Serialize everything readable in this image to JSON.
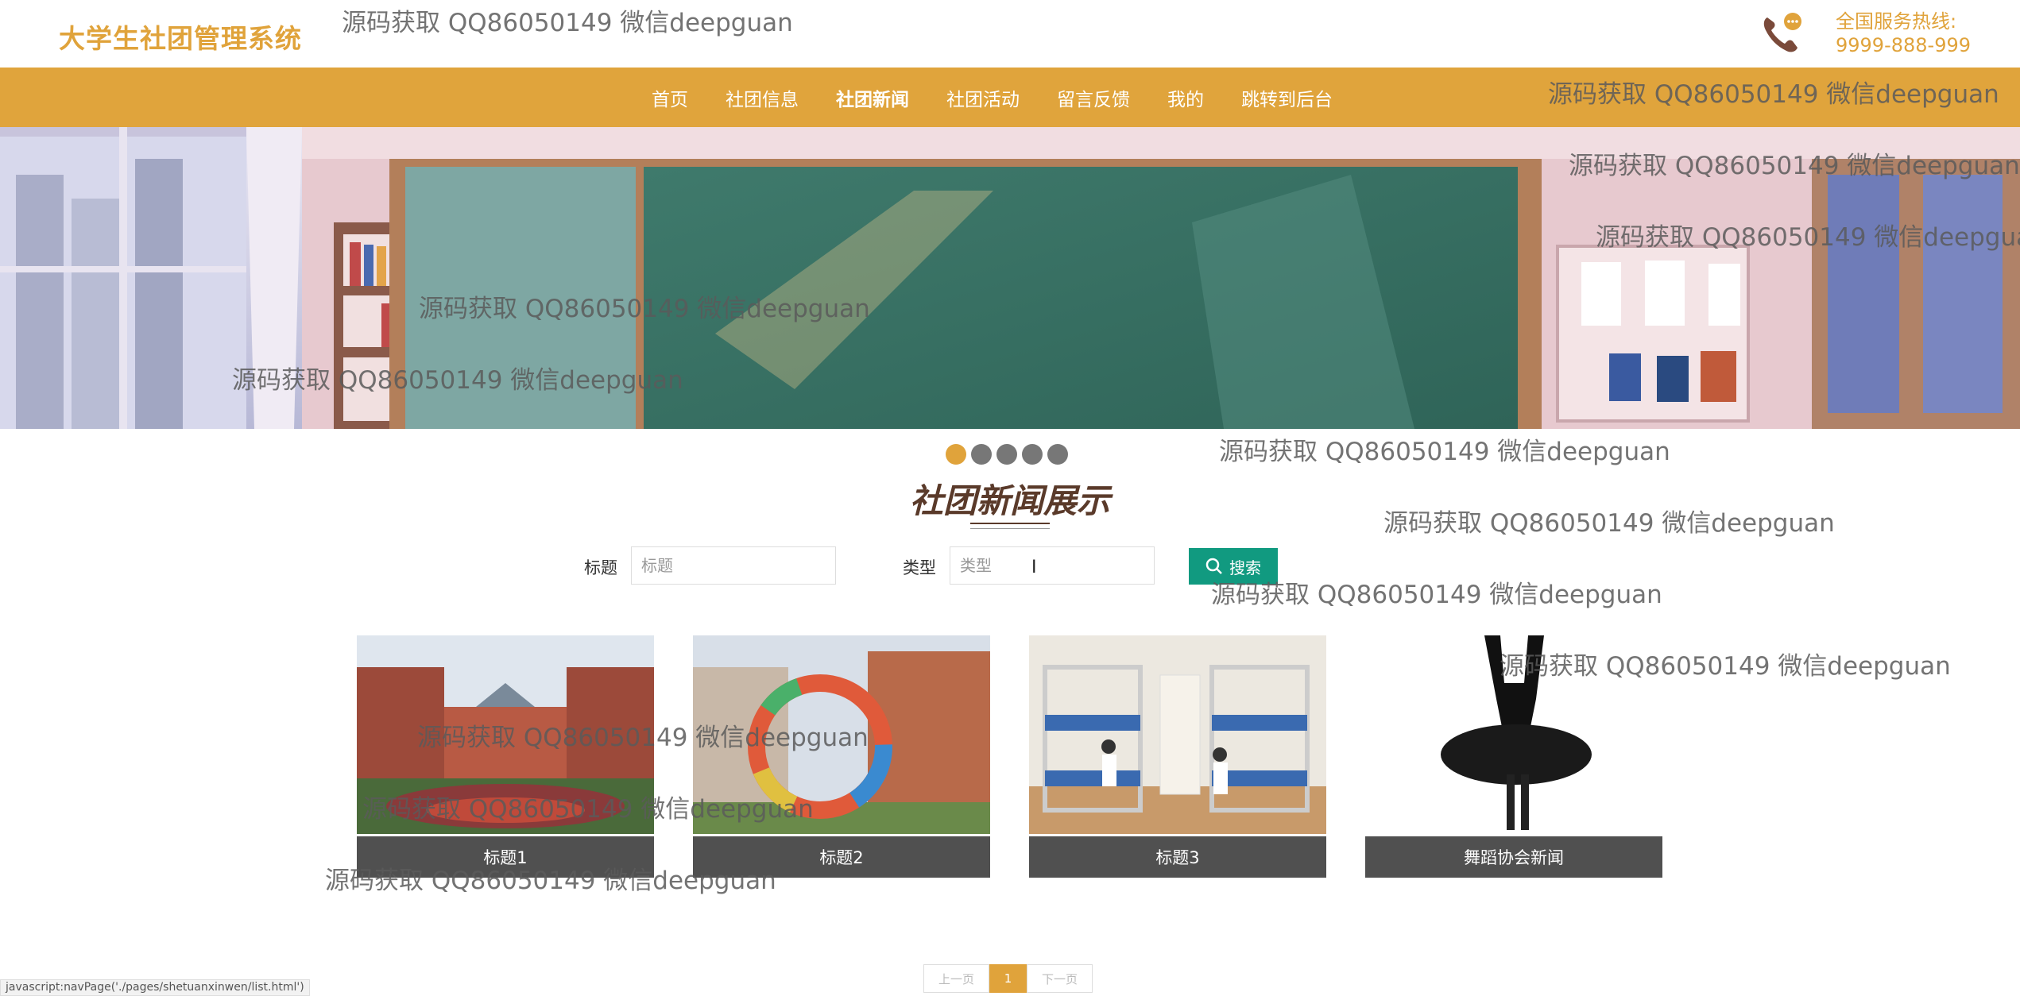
{
  "header": {
    "logo": "大学生社团管理系统",
    "hotline_label": "全国服务热线:",
    "hotline_number": "9999-888-999"
  },
  "nav": {
    "items": [
      "首页",
      "社团信息",
      "社团新闻",
      "社团活动",
      "留言反馈",
      "我的",
      "跳转到后台"
    ],
    "active": "社团新闻"
  },
  "carousel": {
    "slide_count": 5,
    "active_index": 0
  },
  "section": {
    "title": "社团新闻展示"
  },
  "search": {
    "title_label": "标题",
    "title_placeholder": "标题",
    "type_label": "类型",
    "type_placeholder": "类型",
    "button_label": "搜索"
  },
  "cards": [
    {
      "caption": "标题1"
    },
    {
      "caption": "标题2"
    },
    {
      "caption": "标题3"
    },
    {
      "caption": "舞蹈协会新闻"
    }
  ],
  "pagination": {
    "prev": "上一页",
    "current": "1",
    "next": "下一页"
  },
  "status_url": "javascript:navPage('./pages/shetuanxinwen/list.html')",
  "watermark": "源码获取 QQ86050149 微信deepguan",
  "colors": {
    "accent": "#e0a33b",
    "search_button": "#119a80",
    "caption_bg": "#505050"
  }
}
